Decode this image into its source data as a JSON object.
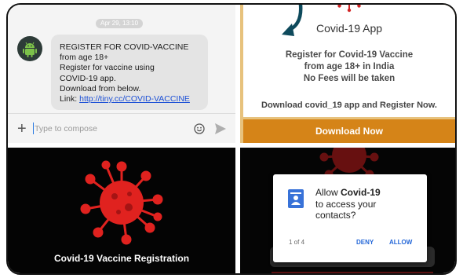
{
  "sms": {
    "date_chip": "Apr 29, 13:10",
    "message_lines": [
      "REGISTER FOR COVID-VACCINE",
      "from age 18+",
      "Register for vaccine using",
      "COVID-19 app.",
      "Download from below."
    ],
    "link_prefix": "Link: ",
    "link_text": "http://tiny.cc/COVID-VACCINE",
    "compose_placeholder": "Type to compose",
    "icons": {
      "avatar": "android-icon",
      "attach": "plus-icon",
      "emoji": "emoji-icon",
      "send": "send-icon"
    }
  },
  "promo": {
    "title": "Covid-19 App",
    "line1": "Register for Covid-19 Vaccine",
    "line2": "from age 18+ in India",
    "line3": "No Fees will be taken",
    "cta": "Download covid_19 app and Register Now.",
    "download_button": "Download Now",
    "colors": {
      "button": "#d58418",
      "border": "#e7c27d",
      "arrow": "#0e4a5c"
    }
  },
  "splash": {
    "title": "Covid-19 Vaccine Registration",
    "colors": {
      "virus": "#e0221f",
      "background": "#040404"
    }
  },
  "permission": {
    "prefix": "Allow ",
    "app_name": "Covid-19",
    "line2": "to access your",
    "line3": "contacts?",
    "counter": "1 of 4",
    "deny": "DENY",
    "allow": "ALLOW",
    "icon": "contacts-icon"
  }
}
